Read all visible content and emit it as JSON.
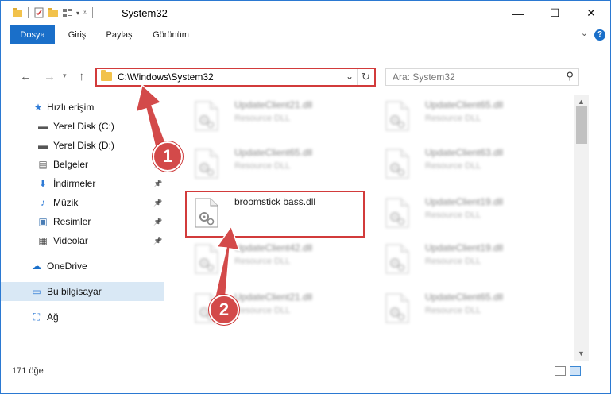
{
  "window": {
    "title": "System32",
    "controls": {
      "minimize": "—",
      "maximize": "☐",
      "close": "✕"
    }
  },
  "ribbon": {
    "tabs": [
      {
        "label": "Dosya",
        "active": true
      },
      {
        "label": "Giriş",
        "active": false
      },
      {
        "label": "Paylaş",
        "active": false
      },
      {
        "label": "Görünüm",
        "active": false
      }
    ],
    "help": "?"
  },
  "navigation": {
    "address": "C:\\Windows\\System32",
    "search_placeholder": "Ara: System32"
  },
  "sidebar": {
    "items": [
      {
        "label": "Hızlı erişim",
        "icon": "star-icon",
        "glyph": "★",
        "color": "#2f7bd6",
        "pinned": false
      },
      {
        "label": "Yerel Disk (C:)",
        "icon": "drive-c-icon",
        "glyph": "▬",
        "color": "#555",
        "pinned": false
      },
      {
        "label": "Yerel Disk (D:)",
        "icon": "drive-d-icon",
        "glyph": "▬",
        "color": "#555",
        "pinned": false
      },
      {
        "label": "Belgeler",
        "icon": "documents-icon",
        "glyph": "▤",
        "color": "#666",
        "pinned": true
      },
      {
        "label": "İndirmeler",
        "icon": "downloads-icon",
        "glyph": "⬇",
        "color": "#2f7bd6",
        "pinned": true
      },
      {
        "label": "Müzik",
        "icon": "music-icon",
        "glyph": "♪",
        "color": "#2f7bd6",
        "pinned": true
      },
      {
        "label": "Resimler",
        "icon": "pictures-icon",
        "glyph": "▣",
        "color": "#4a7db5",
        "pinned": true
      },
      {
        "label": "Videolar",
        "icon": "videos-icon",
        "glyph": "▦",
        "color": "#444",
        "pinned": true
      },
      {
        "label": "OneDrive",
        "icon": "onedrive-icon",
        "glyph": "☁",
        "color": "#1a6fc9",
        "pinned": false
      },
      {
        "label": "Bu bilgisayar",
        "icon": "computer-icon",
        "glyph": "▭",
        "color": "#2f7bd6",
        "pinned": false,
        "selected": true
      },
      {
        "label": "Ağ",
        "icon": "network-icon",
        "glyph": "⛶",
        "color": "#2f7bd6",
        "pinned": false
      }
    ]
  },
  "files": [
    {
      "name": "UpdateClient21.dll",
      "type": "Resource DLL",
      "blurred": true
    },
    {
      "name": "UpdateClient65.dll",
      "type": "Resource DLL",
      "blurred": true
    },
    {
      "name": "UpdateClient65.dll",
      "type": "Resource DLL",
      "blurred": true
    },
    {
      "name": "UpdateClient63.dll",
      "type": "Resource DLL",
      "blurred": true
    },
    {
      "name": "broomstick bass.dll",
      "type": "",
      "blurred": false
    },
    {
      "name": "UpdateClient19.dll",
      "type": "Resource DLL",
      "blurred": true
    },
    {
      "name": "UpdateClient42.dll",
      "type": "Resource DLL",
      "blurred": true
    },
    {
      "name": "UpdateClient19.dll",
      "type": "Resource DLL",
      "blurred": true
    },
    {
      "name": "UpdateClient21.dll",
      "type": "Resource DLL",
      "blurred": true
    },
    {
      "name": "UpdateClient65.dll",
      "type": "Resource DLL",
      "blurred": true
    }
  ],
  "status": {
    "item_count": "171 öğe"
  },
  "annotations": {
    "step1": "1",
    "step2": "2"
  },
  "colors": {
    "accent": "#1a6fc9",
    "highlight": "#d23b3b",
    "arrow": "#d34a4a"
  }
}
